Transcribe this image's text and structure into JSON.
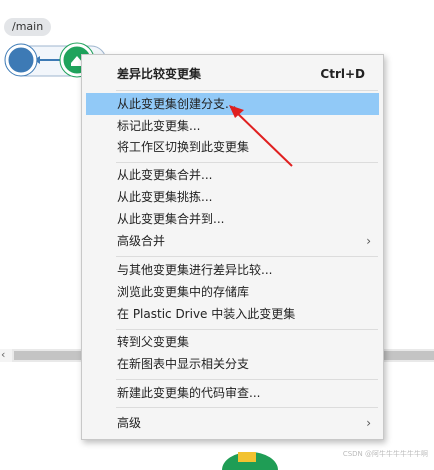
{
  "branch": {
    "label": "/main"
  },
  "menu": {
    "items": [
      {
        "label": "差异比较变更集",
        "shortcut": "Ctrl+D",
        "bold": true
      },
      {
        "label": "从此变更集创建分支...",
        "highlighted": true
      },
      {
        "label": "标记此变更集..."
      },
      {
        "label": "将工作区切换到此变更集"
      },
      {
        "label": "从此变更集合并..."
      },
      {
        "label": "从此变更集挑拣..."
      },
      {
        "label": "从此变更集合并到..."
      },
      {
        "label": "高级合并",
        "submenu": "›"
      },
      {
        "label": "与其他变更集进行差异比较..."
      },
      {
        "label": "浏览此变更集中的存储库"
      },
      {
        "label": "在 Plastic Drive 中装入此变更集"
      },
      {
        "label": "转到父变更集"
      },
      {
        "label": "在新图表中显示相关分支"
      },
      {
        "label": "新建此变更集的代码审查..."
      },
      {
        "label": "高级",
        "submenu": "›"
      }
    ]
  },
  "scrollbar": {
    "left_arrow": "‹"
  },
  "watermark": "CSDN @阿牛牛牛牛牛牛啊",
  "colors": {
    "highlight": "#91c9f7",
    "node_blue": "#3d7ab5",
    "node_green": "#1fa35c",
    "annotation_arrow": "#e02020"
  }
}
